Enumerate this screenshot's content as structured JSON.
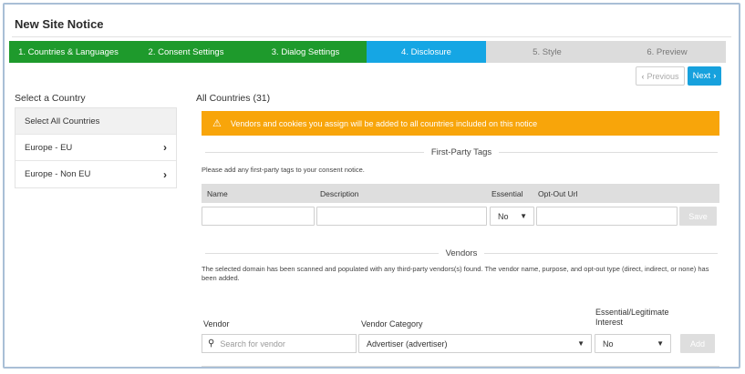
{
  "page": {
    "title": "New Site Notice"
  },
  "steps": [
    {
      "label": "1. Countries & Languages",
      "state": "done"
    },
    {
      "label": "2. Consent Settings",
      "state": "done"
    },
    {
      "label": "3. Dialog Settings",
      "state": "done"
    },
    {
      "label": "4. Disclosure",
      "state": "active"
    },
    {
      "label": "5. Style",
      "state": "todo"
    },
    {
      "label": "6. Preview",
      "state": "todo"
    }
  ],
  "pager": {
    "previous_label": "Previous",
    "next_label": "Next"
  },
  "countries": {
    "title": "Select a Country",
    "items": [
      {
        "label": "Select All Countries"
      },
      {
        "label": "Europe - EU"
      },
      {
        "label": "Europe - Non EU"
      }
    ]
  },
  "main": {
    "title": "All Countries (31)",
    "alert": "Vendors and cookies you assign will be added to all countries included on this notice"
  },
  "first_party": {
    "heading": "First-Party Tags",
    "help": "Please add any first-party tags to your consent notice.",
    "columns": {
      "name": "Name",
      "description": "Description",
      "essential": "Essential",
      "optout": "Opt-Out Url"
    },
    "essential_value": "No",
    "save_label": "Save"
  },
  "vendors": {
    "heading": "Vendors",
    "help": "The selected domain has been scanned and populated with any third-party vendors(s) found. The vendor name, purpose, and opt-out type (direct, indirect, or none) has been added.",
    "vendor_label": "Vendor",
    "category_label": "Vendor Category",
    "essential_label": "Essential/Legitimate Interest",
    "search_placeholder": "Search for vendor",
    "category_value": "Advertiser (advertiser)",
    "essential_value": "No",
    "add_label": "Add"
  },
  "colors": {
    "step_done": "#1e9a2c",
    "step_active": "#15a6e4",
    "step_todo": "#dcdcdc",
    "alert": "#f8a50a",
    "next_button": "#17a1dd"
  }
}
